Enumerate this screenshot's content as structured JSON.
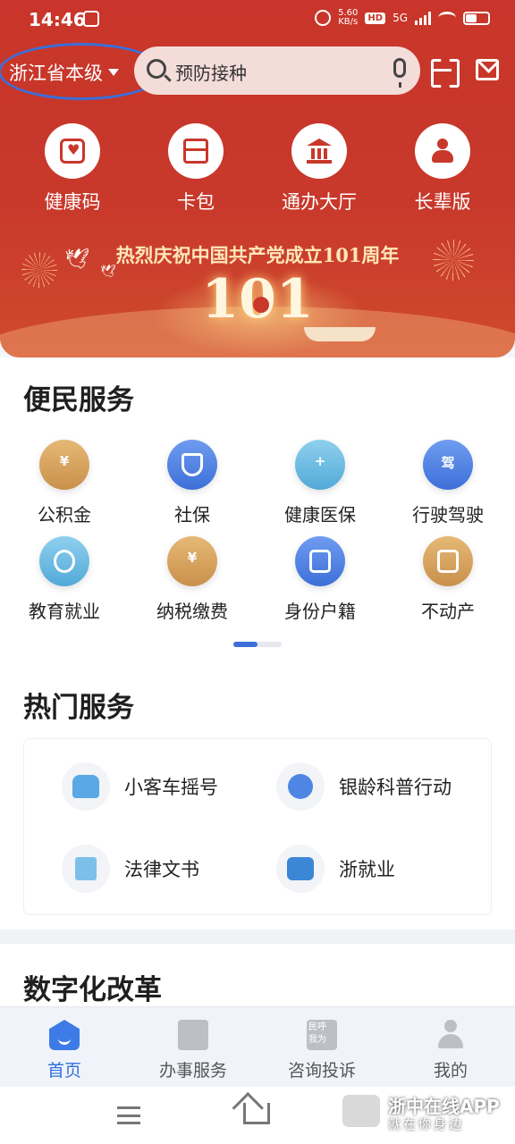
{
  "status": {
    "time": "14:46",
    "net_speed": "5.60",
    "net_unit": "KB/s",
    "hd": "HD",
    "network": "5G"
  },
  "header": {
    "region": "浙江省本级",
    "search_text": "预防接种",
    "quick": [
      {
        "label": "健康码",
        "icon": "health-code-icon"
      },
      {
        "label": "卡包",
        "icon": "wallet-icon"
      },
      {
        "label": "通办大厅",
        "icon": "hall-icon"
      },
      {
        "label": "长辈版",
        "icon": "elder-mode-icon"
      }
    ]
  },
  "banner": {
    "slogan": "热烈庆祝中国共产党成立101周年",
    "big": "101"
  },
  "convenience": {
    "title": "便民服务",
    "items": [
      {
        "label": "公积金",
        "glyph": "¥"
      },
      {
        "label": "社保",
        "glyph": ""
      },
      {
        "label": "健康医保",
        "glyph": "+"
      },
      {
        "label": "行驶驾驶",
        "glyph": "驾"
      },
      {
        "label": "教育就业",
        "glyph": ""
      },
      {
        "label": "纳税缴费",
        "glyph": "¥"
      },
      {
        "label": "身份户籍",
        "glyph": ""
      },
      {
        "label": "不动产",
        "glyph": ""
      }
    ],
    "pager": {
      "pages": 2,
      "current": 1
    }
  },
  "hot": {
    "title": "热门服务",
    "items": [
      {
        "label": "小客车摇号",
        "icon": "car-icon"
      },
      {
        "label": "银龄科普行动",
        "icon": "flower-icon"
      },
      {
        "label": "法律文书",
        "icon": "document-icon"
      },
      {
        "label": "浙就业",
        "icon": "briefcase-icon"
      }
    ]
  },
  "digital": {
    "title": "数字化改革"
  },
  "tabbar": {
    "tabs": [
      {
        "label": "首页",
        "active": true
      },
      {
        "label": "办事服务",
        "active": false
      },
      {
        "label": "咨询投诉",
        "active": false
      },
      {
        "label": "我的",
        "active": false
      }
    ]
  },
  "watermark": {
    "title": "浙中在线APP",
    "subtitle": "就在你身边"
  },
  "colors": {
    "brand_red": "#c8382b",
    "accent_blue": "#2f6fdc",
    "highlight_ring": "#3b6fd8"
  }
}
